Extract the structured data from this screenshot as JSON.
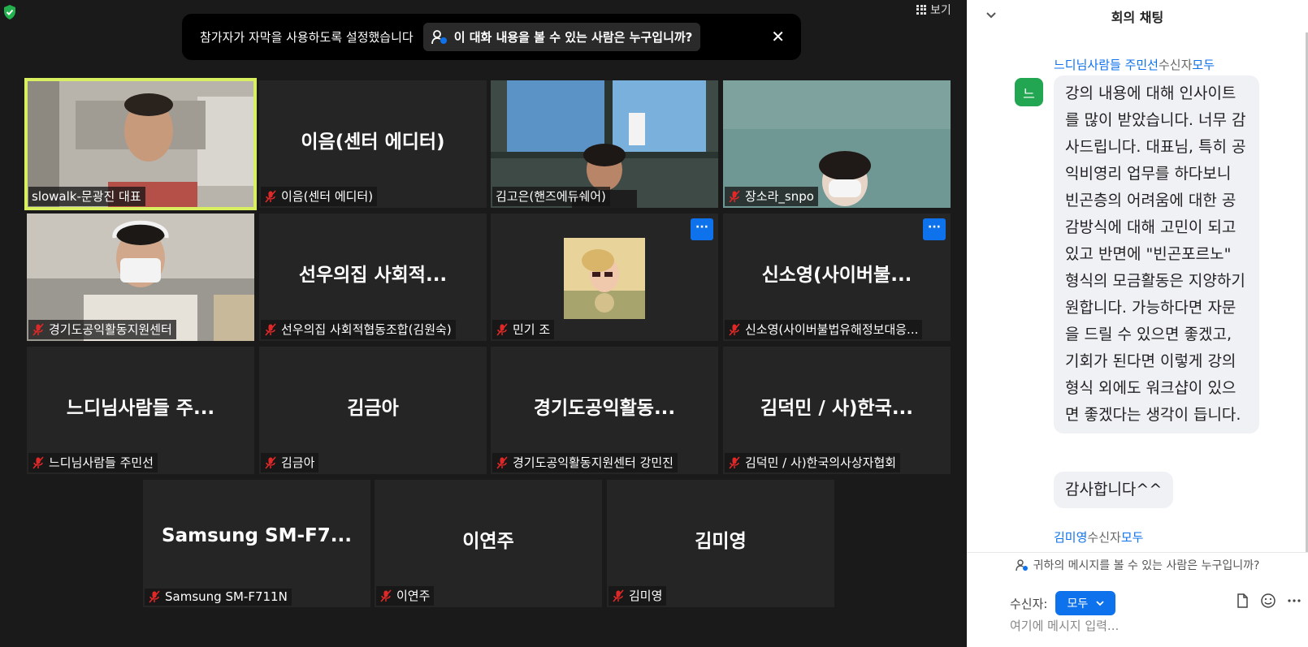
{
  "banner": {
    "text": "참가자가 자막을 사용하도록 설정했습니다",
    "link": "이 대화 내용을 볼 수 있는 사람은 누구입니까?"
  },
  "view": {
    "label": "보기"
  },
  "tiles": [
    {
      "big": "",
      "label": "slowalk-문광진 대표",
      "muted": false,
      "video": "person1",
      "active": true
    },
    {
      "big": "이음(센터 에디터)",
      "label": "이음(센터 에디터)",
      "muted": true
    },
    {
      "big": "",
      "label": "김고은(핸즈에듀쉐어)",
      "muted": false,
      "video": "person3"
    },
    {
      "big": "",
      "label": "장소라_snpo",
      "muted": true,
      "video": "person4"
    },
    {
      "big": "",
      "label": "경기도공익활동지원센터",
      "muted": true,
      "video": "person5"
    },
    {
      "big": "선우의집 사회적...",
      "label": "선우의집 사회적협동조합(김원숙)",
      "muted": true
    },
    {
      "big": "",
      "label": "민기 조",
      "muted": true,
      "video": "avatar",
      "more": true
    },
    {
      "big": "신소영(사이버불...",
      "label": "신소영(사이버불법유해정보대응...",
      "muted": true,
      "more": true
    },
    {
      "big": "느디님사람들 주...",
      "label": "느디님사람들 주민선",
      "muted": true
    },
    {
      "big": "김금아",
      "label": "김금아",
      "muted": true
    },
    {
      "big": "경기도공익활동...",
      "label": "경기도공익활동지원센터 강민진",
      "muted": true
    },
    {
      "big": "김덕민 / 사)한국...",
      "label": "김덕민 / 사)한국의사상자협회",
      "muted": true
    },
    {
      "big": "Samsung SM-F7...",
      "label": "Samsung SM-F711N",
      "muted": true
    },
    {
      "big": "이연주",
      "label": "이연주",
      "muted": true
    },
    {
      "big": "김미영",
      "label": "김미영",
      "muted": true
    }
  ],
  "chat": {
    "title": "회의 채팅",
    "messages": [
      {
        "sender": "느디님사람들 주민선",
        "to_label": "수신자",
        "to": "모두",
        "avatar": "느",
        "texts": [
          "강의 내용에 대해 인사이트를 많이 받았습니다. 너무 감사드립니다. 대표님, 특히 공익비영리 업무를 하다보니 빈곤층의 어려움에 대한 공감방식에 대해 고민이 되고 있고 반면에 \"빈곤포르노\" 형식의 모금활동은 지양하기 원합니다. 가능하다면 자문을 드릴 수 있으면 좋겠고, 기회가 된다면 이렇게 강의형식 외에도 워크샵이 있으면 좋겠다는 생각이 듭니다.",
          "감사합니다^^"
        ]
      },
      {
        "sender": "김미영",
        "to_label": "수신자",
        "to": "모두"
      }
    ],
    "privacy": "귀하의 메시지를 볼 수 있는 사람은 누구입니까?",
    "recipient_label": "수신자:",
    "recipient_value": "모두",
    "input_placeholder": "여기에 메시지 입력..."
  }
}
